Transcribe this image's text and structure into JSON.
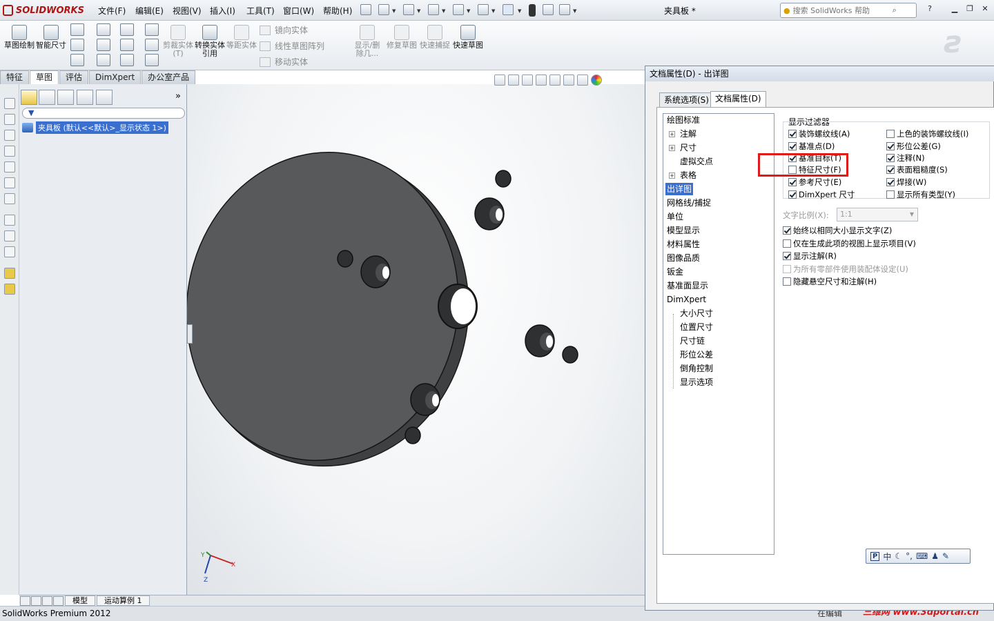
{
  "app": {
    "logo": "SOLIDWORKS",
    "doc_title": "夹具板 *",
    "menu": [
      "文件(F)",
      "编辑(E)",
      "视图(V)",
      "插入(I)",
      "工具(T)",
      "窗口(W)",
      "帮助(H)"
    ],
    "help_search_placeholder": "搜索 SolidWorks 帮助",
    "help_label": "?"
  },
  "command_manager": {
    "big_buttons": [
      {
        "label": "草图绘制",
        "enabled": true
      },
      {
        "label": "智能尺寸",
        "enabled": true
      },
      {
        "label": "剪裁实体(T)",
        "enabled": false
      },
      {
        "label": "转换实体引用",
        "enabled": true
      },
      {
        "label": "等距实体",
        "enabled": false
      },
      {
        "label": "显示/删除几...",
        "enabled": false
      },
      {
        "label": "修复草图",
        "enabled": false
      },
      {
        "label": "快速捕捉",
        "enabled": false
      },
      {
        "label": "快速草图",
        "enabled": true
      }
    ],
    "row_tools": [
      "镜向实体",
      "线性草图阵列",
      "移动实体"
    ]
  },
  "cmd_tabs": [
    "特征",
    "草图",
    "评估",
    "DimXpert",
    "办公室产品"
  ],
  "cmd_tab_active": "草图",
  "feature_manager": {
    "root_item": "夹具板 (默认<<默认>_显示状态 1>)"
  },
  "bottom_tabs": [
    "模型",
    "运动算例 1"
  ],
  "status": {
    "left": "SolidWorks Premium 2012",
    "right_partial": "在编辑",
    "watermark": "三维网 www.3dportal.cn"
  },
  "triad": {
    "x": "X",
    "y": "Y",
    "z": "Z"
  },
  "dialog": {
    "title": "文档属性(D) - 出详图",
    "tabs": [
      "系统选项(S)",
      "文档属性(D)"
    ],
    "active_tab": "文档属性(D)",
    "tree": [
      {
        "label": "绘图标准",
        "indent": 0,
        "expand": false
      },
      {
        "label": "注解",
        "indent": 1,
        "expand": true
      },
      {
        "label": "尺寸",
        "indent": 1,
        "expand": true
      },
      {
        "label": "虚拟交点",
        "indent": 1,
        "expand": false
      },
      {
        "label": "表格",
        "indent": 1,
        "expand": true
      },
      {
        "label": "出详图",
        "indent": 0,
        "expand": false,
        "selected": true
      },
      {
        "label": "网格线/捕捉",
        "indent": 0,
        "expand": false
      },
      {
        "label": "单位",
        "indent": 0,
        "expand": false
      },
      {
        "label": "模型显示",
        "indent": 0,
        "expand": false
      },
      {
        "label": "材料属性",
        "indent": 0,
        "expand": false
      },
      {
        "label": "图像品质",
        "indent": 0,
        "expand": false
      },
      {
        "label": "钣金",
        "indent": 0,
        "expand": false
      },
      {
        "label": "基准面显示",
        "indent": 0,
        "expand": false
      },
      {
        "label": "DimXpert",
        "indent": 0,
        "expand": false
      },
      {
        "label": "大小尺寸",
        "indent": 1,
        "expand": false
      },
      {
        "label": "位置尺寸",
        "indent": 1,
        "expand": false
      },
      {
        "label": "尺寸链",
        "indent": 1,
        "expand": false
      },
      {
        "label": "形位公差",
        "indent": 1,
        "expand": false
      },
      {
        "label": "倒角控制",
        "indent": 1,
        "expand": false
      },
      {
        "label": "显示选项",
        "indent": 1,
        "expand": false
      }
    ],
    "filter_header": "显示过滤器",
    "filters_left": [
      {
        "label": "装饰螺纹线(A)",
        "checked": true
      },
      {
        "label": "基准点(D)",
        "checked": true
      },
      {
        "label": "基准目标(T)",
        "checked": true
      },
      {
        "label": "特征尺寸(F)",
        "checked": false
      },
      {
        "label": "参考尺寸(E)",
        "checked": true
      },
      {
        "label": "DimXpert 尺寸",
        "checked": true
      }
    ],
    "filters_right": [
      {
        "label": "上色的装饰螺纹线(I)",
        "checked": false
      },
      {
        "label": "形位公差(G)",
        "checked": true
      },
      {
        "label": "注释(N)",
        "checked": true
      },
      {
        "label": "表面粗糙度(S)",
        "checked": true
      },
      {
        "label": "焊接(W)",
        "checked": true
      },
      {
        "label": "显示所有类型(Y)",
        "checked": false
      }
    ],
    "text_scale_label": "文字比例(X):",
    "text_scale_value": "1:1",
    "options": [
      {
        "label": "始终以相同大小显示文字(Z)",
        "checked": true,
        "enabled": true
      },
      {
        "label": "仅在生成此项的视图上显示项目(V)",
        "checked": false,
        "enabled": true
      },
      {
        "label": "显示注解(R)",
        "checked": true,
        "enabled": true
      },
      {
        "label": "为所有零部件使用装配体设定(U)",
        "checked": false,
        "enabled": false
      },
      {
        "label": "隐藏悬空尺寸和注解(H)",
        "checked": false,
        "enabled": true
      }
    ]
  },
  "ime_bar": {
    "label": "中"
  },
  "colors": {
    "part_face": "#58595b",
    "part_rim": "#3f4042",
    "highlight_box": "#e01919",
    "selection": "#3a6fd0"
  }
}
